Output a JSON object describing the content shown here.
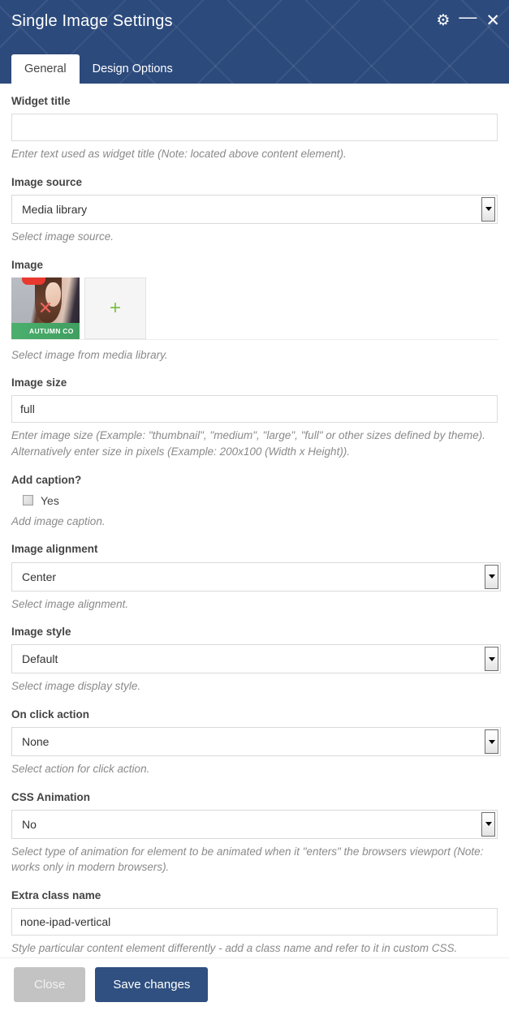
{
  "window": {
    "title": "Single Image Settings",
    "controls": [
      {
        "name": "settings-gear",
        "glyph": "⚙"
      },
      {
        "name": "minimize",
        "glyph": "—"
      },
      {
        "name": "close",
        "glyph": "✕"
      }
    ]
  },
  "tabs": [
    {
      "label": "General",
      "active": true
    },
    {
      "label": "Design Options",
      "active": false
    }
  ],
  "fields": {
    "widget_title": {
      "label": "Widget title",
      "value": "",
      "placeholder": "",
      "description": "Enter text used as widget title (Note: located above content element)."
    },
    "image_source": {
      "label": "Image source",
      "value": "Media library",
      "description": "Select image source."
    },
    "image": {
      "label": "Image",
      "description": "Select image from media library.",
      "thumbnail_banner": "AUTUMN CO",
      "remove_icon": "✕",
      "add_icon": "+"
    },
    "image_size": {
      "label": "Image size",
      "value": "full",
      "description": "Enter image size (Example: \"thumbnail\", \"medium\", \"large\", \"full\" or other sizes defined by theme). Alternatively enter size in pixels (Example: 200x100 (Width x Height))."
    },
    "add_caption": {
      "label": "Add caption?",
      "checkbox_label": "Yes",
      "checked": false,
      "description": "Add image caption."
    },
    "image_alignment": {
      "label": "Image alignment",
      "value": "Center",
      "description": "Select image alignment."
    },
    "image_style": {
      "label": "Image style",
      "value": "Default",
      "description": "Select image display style."
    },
    "on_click_action": {
      "label": "On click action",
      "value": "None",
      "description": "Select action for click action."
    },
    "css_animation": {
      "label": "CSS Animation",
      "value": "No",
      "description": "Select type of animation for element to be animated when it \"enters\" the browsers viewport (Note: works only in modern browsers)."
    },
    "extra_class_name": {
      "label": "Extra class name",
      "value": "none-ipad-vertical",
      "description": "Style particular content element differently - add a class name and refer to it in custom CSS."
    }
  },
  "footer": {
    "close_label": "Close",
    "save_label": "Save changes"
  },
  "colors": {
    "header_blue": "#2c4a7c",
    "save_button": "#2f5080",
    "close_button": "#c3c3c3",
    "accent_green": "#7ac143",
    "remove_red": "#f0635c"
  }
}
